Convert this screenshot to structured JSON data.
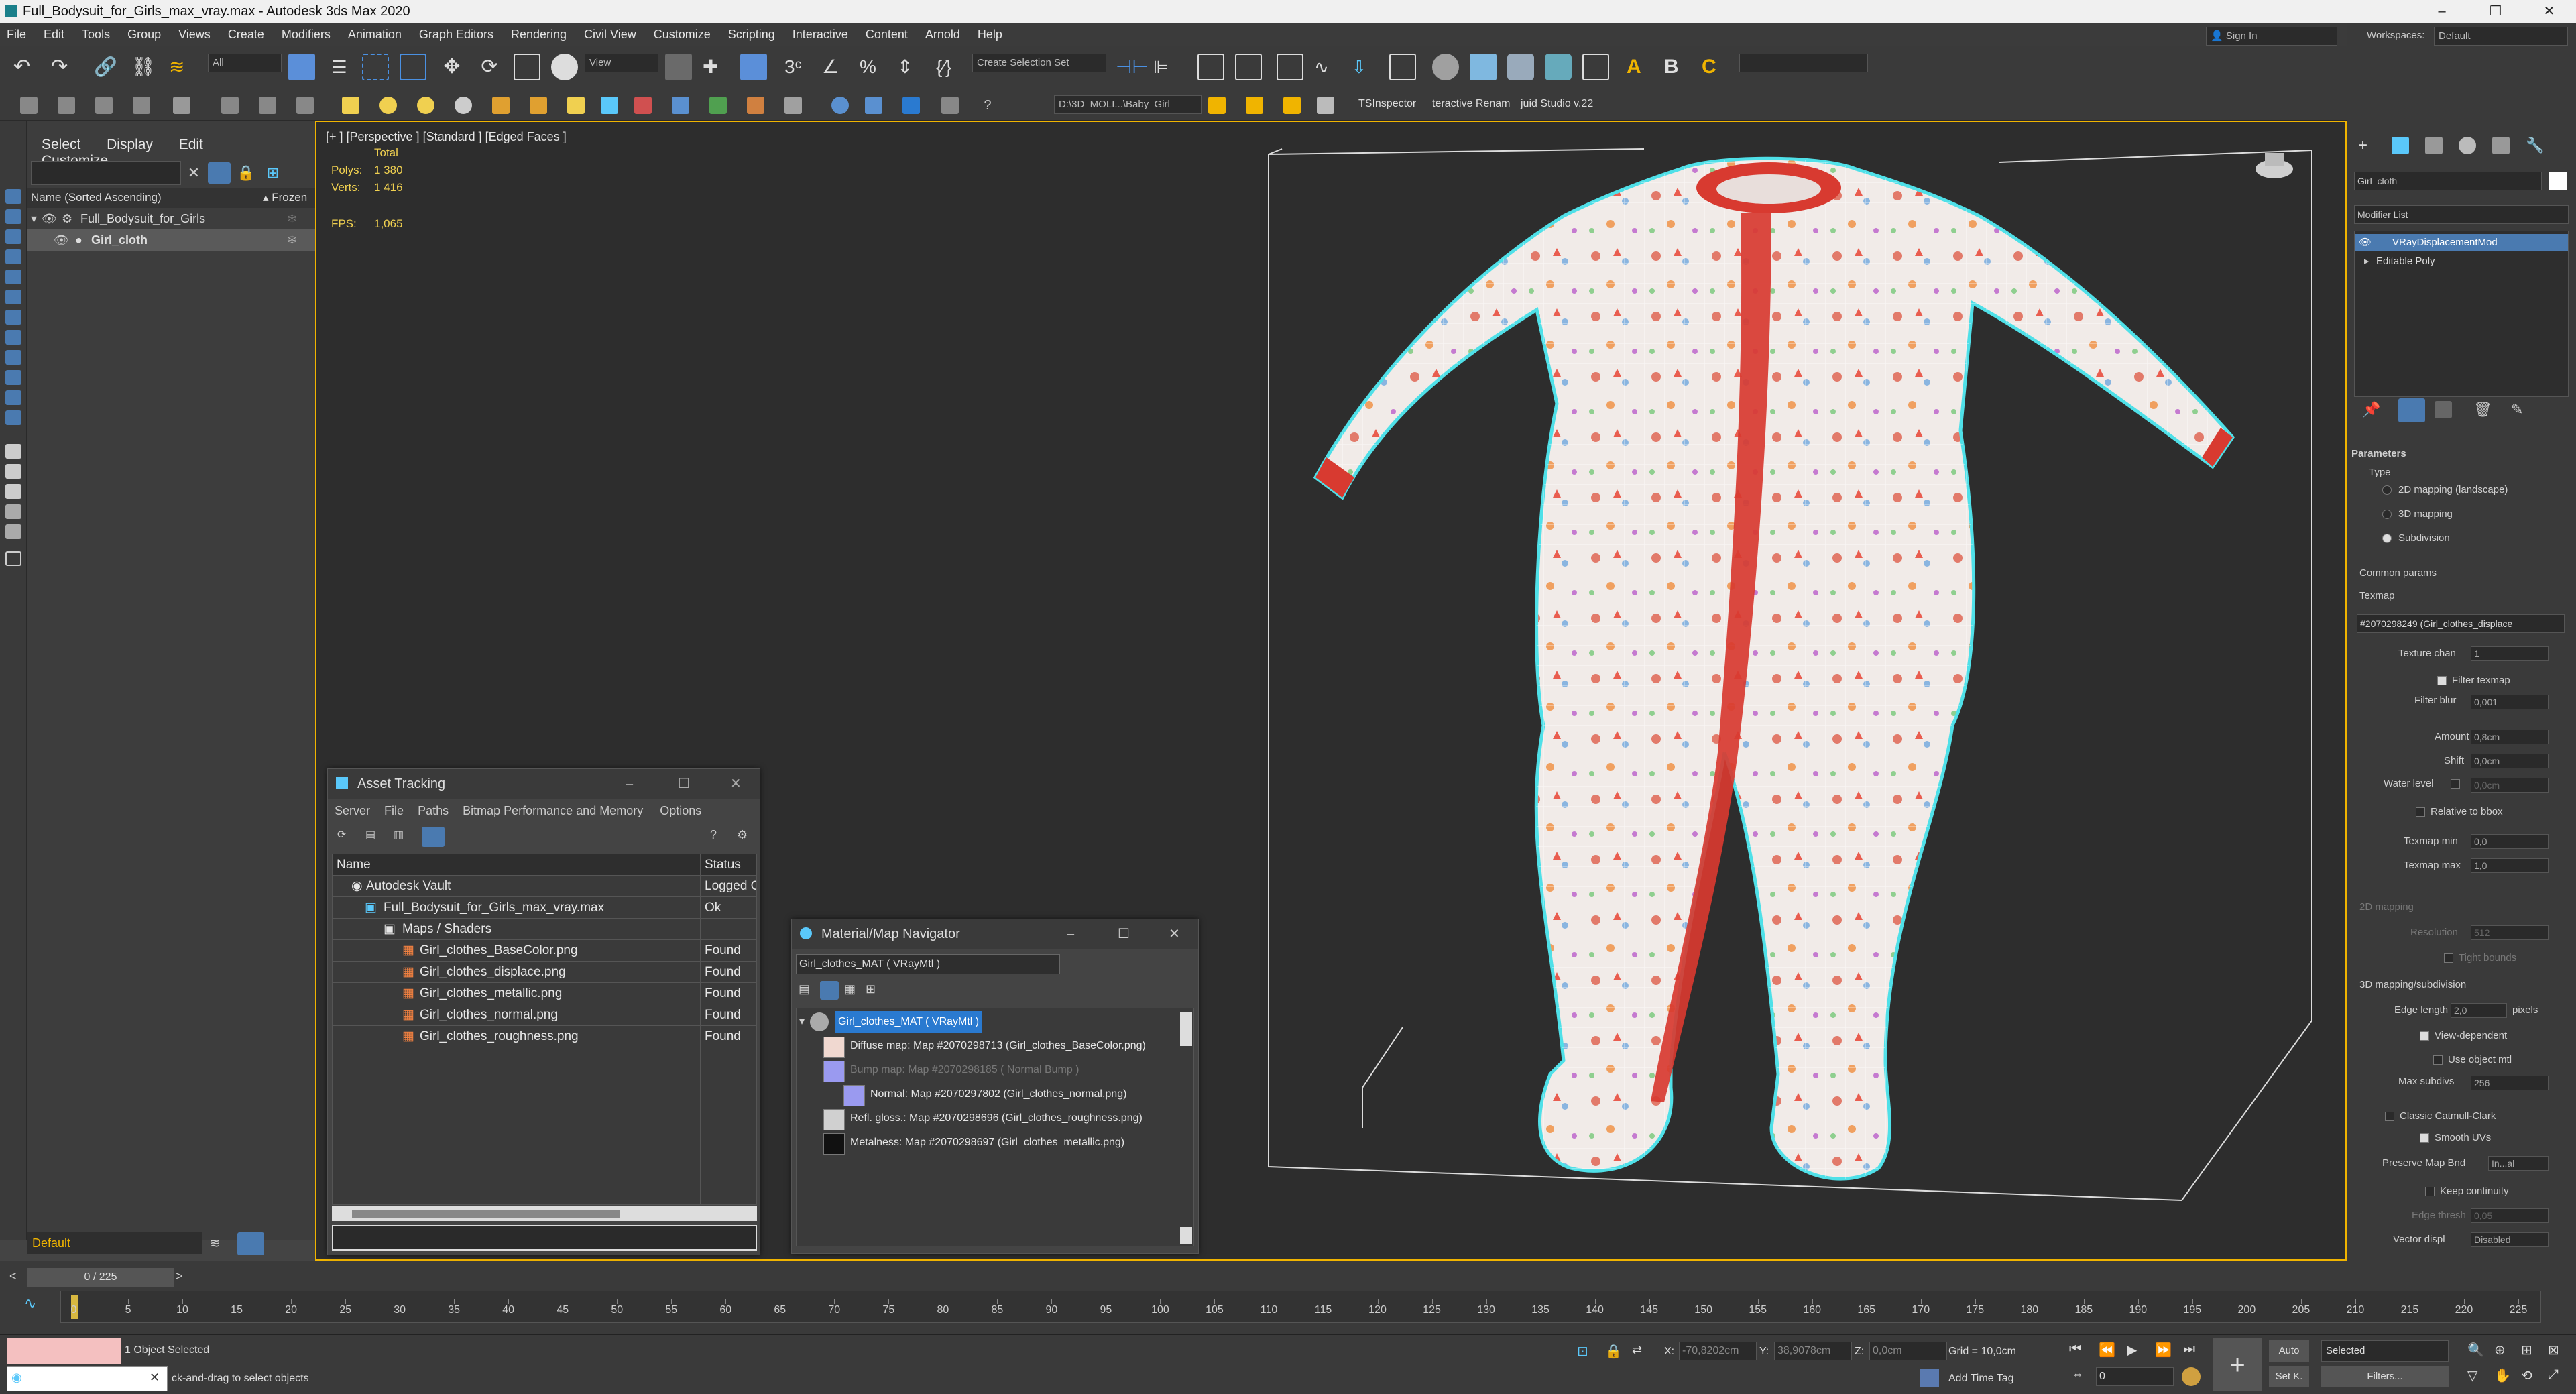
{
  "window": {
    "title": "Full_Bodysuit_for_Girls_max_vray.max - Autodesk 3ds Max 2020",
    "controls": [
      "–",
      "❐",
      "✕"
    ]
  },
  "menu": [
    "File",
    "Edit",
    "Tools",
    "Group",
    "Views",
    "Create",
    "Modifiers",
    "Animation",
    "Graph Editors",
    "Rendering",
    "Civil View",
    "Customize",
    "Scripting",
    "Interactive",
    "Content",
    "Arnold",
    "Help"
  ],
  "header_right": {
    "sign_in": "Sign In",
    "workspaces_label": "Workspaces:",
    "workspace_value": "Default"
  },
  "toolbar": {
    "filter_value": "All",
    "view_value": "View",
    "selection_set_placeholder": "Create Selection Set",
    "project_path": "D:\\3D_MOLI...\\Baby_Girl",
    "ts_inspector": "TSInspector",
    "renamer": "teractive Renam",
    "studio": "juid Studio v.22"
  },
  "scene_explorer": {
    "tabs": [
      "Select",
      "Display",
      "Edit",
      "Customize"
    ],
    "column_name": "Name (Sorted Ascending)",
    "column_frozen": "▴ Frozen",
    "rows": [
      {
        "name": "Full_Bodysuit_for_Girls"
      },
      {
        "name": "Girl_cloth"
      }
    ],
    "layer": "Default"
  },
  "viewport": {
    "label": "[+ ] [Perspective ] [Standard ] [Edged Faces ]",
    "stats_total": "Total",
    "polys_label": "Polys:",
    "polys_value": "1 380",
    "verts_label": "Verts:",
    "verts_value": "1 416",
    "fps_label": "FPS:",
    "fps_value": "1,065"
  },
  "asset_tracking": {
    "title": "Asset Tracking",
    "menu": [
      "Server",
      "File",
      "Paths",
      "Bitmap Performance and Memory",
      "Options"
    ],
    "col_name": "Name",
    "col_status": "Status",
    "rows": [
      {
        "name": "Autodesk Vault",
        "status": "Logged C"
      },
      {
        "name": "Full_Bodysuit_for_Girls_max_vray.max",
        "status": "Ok"
      },
      {
        "name": "Maps / Shaders",
        "status": ""
      },
      {
        "name": "Girl_clothes_BaseColor.png",
        "status": "Found"
      },
      {
        "name": "Girl_clothes_displace.png",
        "status": "Found"
      },
      {
        "name": "Girl_clothes_metallic.png",
        "status": "Found"
      },
      {
        "name": "Girl_clothes_normal.png",
        "status": "Found"
      },
      {
        "name": "Girl_clothes_roughness.png",
        "status": "Found"
      }
    ]
  },
  "material_navigator": {
    "title": "Material/Map Navigator",
    "current": "Girl_clothes_MAT  ( VRayMtl )",
    "root": "Girl_clothes_MAT  ( VRayMtl )",
    "items": [
      "Diffuse map: Map #2070298713 (Girl_clothes_BaseColor.png)",
      "Bump map: Map #2070298185  ( Normal Bump )",
      "Normal: Map #2070297802 (Girl_clothes_normal.png)",
      "Refl. gloss.: Map #2070298696 (Girl_clothes_roughness.png)",
      "Metalness: Map #2070298697 (Girl_clothes_metallic.png)"
    ]
  },
  "command_panel": {
    "object_name": "Girl_cloth",
    "modifier_list": "Modifier List",
    "stack": [
      "VRayDisplacementMod",
      "Editable Poly"
    ],
    "rollout": "Parameters",
    "type_label": "Type",
    "type_options": [
      "2D mapping (landscape)",
      "3D mapping",
      "Subdivision"
    ],
    "common_params": "Common params",
    "texmap_label": "Texmap",
    "texmap_value": "#2070298249 (Girl_clothes_displace",
    "texture_chan_label": "Texture chan",
    "texture_chan_value": "1",
    "filter_texmap": "Filter texmap",
    "filter_blur_label": "Filter blur",
    "filter_blur_value": "0,001",
    "amount_label": "Amount",
    "amount_value": "0,8cm",
    "shift_label": "Shift",
    "shift_value": "0,0cm",
    "water_level_label": "Water level",
    "water_level_value": "0,0cm",
    "relative_to_bbox": "Relative to bbox",
    "texmap_min_label": "Texmap min",
    "texmap_min_value": "0,0",
    "texmap_max_label": "Texmap max",
    "texmap_max_value": "1,0",
    "mapping_2d": "2D mapping",
    "resolution_label": "Resolution",
    "resolution_value": "512",
    "tight_bounds": "Tight bounds",
    "mapping_3d": "3D mapping/subdivision",
    "edge_length_label": "Edge length",
    "edge_length_value": "2,0",
    "pixels": "pixels",
    "view_dependent": "View-dependent",
    "use_object_mtl": "Use object mtl",
    "max_subdivs_label": "Max subdivs",
    "max_subdivs_value": "256",
    "classic_catmull": "Classic Catmull-Clark",
    "smooth_uvs": "Smooth UVs",
    "preserve_map_bnd_label": "Preserve Map Bnd",
    "preserve_map_bnd_value": "In...al",
    "keep_continuity": "Keep continuity",
    "edge_thresh_label": "Edge thresh",
    "edge_thresh_value": "0,05",
    "vector_displ_label": "Vector displ",
    "vector_displ_value": "Disabled"
  },
  "timeline": {
    "frame_counter": "0 / 225",
    "ticks": [
      "0",
      "5",
      "10",
      "15",
      "20",
      "25",
      "30",
      "35",
      "40",
      "45",
      "50",
      "55",
      "60",
      "65",
      "70",
      "75",
      "80",
      "85",
      "90",
      "95",
      "100",
      "105",
      "110",
      "115",
      "120",
      "125",
      "130",
      "135",
      "140",
      "145",
      "150",
      "155",
      "160",
      "165",
      "170",
      "175",
      "180",
      "185",
      "190",
      "195",
      "200",
      "205",
      "210",
      "215",
      "220",
      "225"
    ]
  },
  "status": {
    "selection": "1 Object Selected",
    "prompt": "ck-and-drag to select objects",
    "x_label": "X:",
    "x_value": "-70,8202cm",
    "y_label": "Y:",
    "y_value": "38,9078cm",
    "z_label": "Z:",
    "z_value": "0,0cm",
    "grid": "Grid = 10,0cm",
    "add_time_tag": "Add Time Tag",
    "auto": "Auto",
    "set_k": "Set K.",
    "selected": "Selected",
    "filters": "Filters...",
    "frame": "0"
  }
}
